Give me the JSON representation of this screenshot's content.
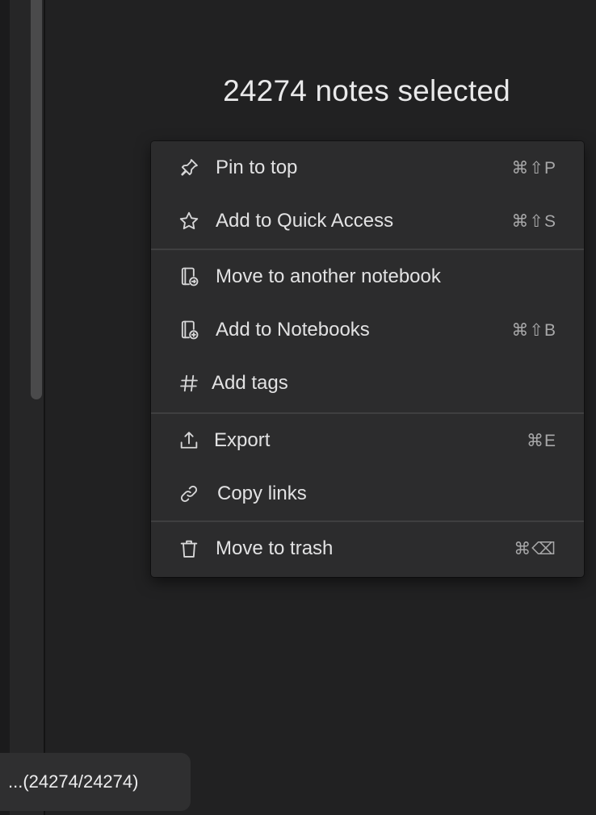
{
  "selection": {
    "title": "24274 notes selected"
  },
  "menu": {
    "items": [
      {
        "label": "Pin to top",
        "shortcut": "⌘⇧P",
        "icon": "pin-icon"
      },
      {
        "label": "Add to Quick Access",
        "shortcut": "⌘⇧S",
        "icon": "star-icon"
      },
      {
        "label": "Move to another notebook",
        "shortcut": "",
        "icon": "notebook-move-icon"
      },
      {
        "label": "Add to Notebooks",
        "shortcut": "⌘⇧B",
        "icon": "notebook-add-icon"
      },
      {
        "label": "Add tags",
        "shortcut": "",
        "icon": "hash-icon"
      },
      {
        "label": "Export",
        "shortcut": "⌘E",
        "icon": "export-icon"
      },
      {
        "label": "Copy links",
        "shortcut": "",
        "icon": "link-icon"
      },
      {
        "label": "Move to trash",
        "shortcut": "⌘⌫",
        "icon": "trash-icon"
      }
    ]
  },
  "status": {
    "progress_text": "...(24274/24274)"
  },
  "colors": {
    "background": "#212122",
    "menu_background": "#2c2c2d",
    "text": "#e2e2e3",
    "shortcut_text": "#a8a8a9"
  }
}
